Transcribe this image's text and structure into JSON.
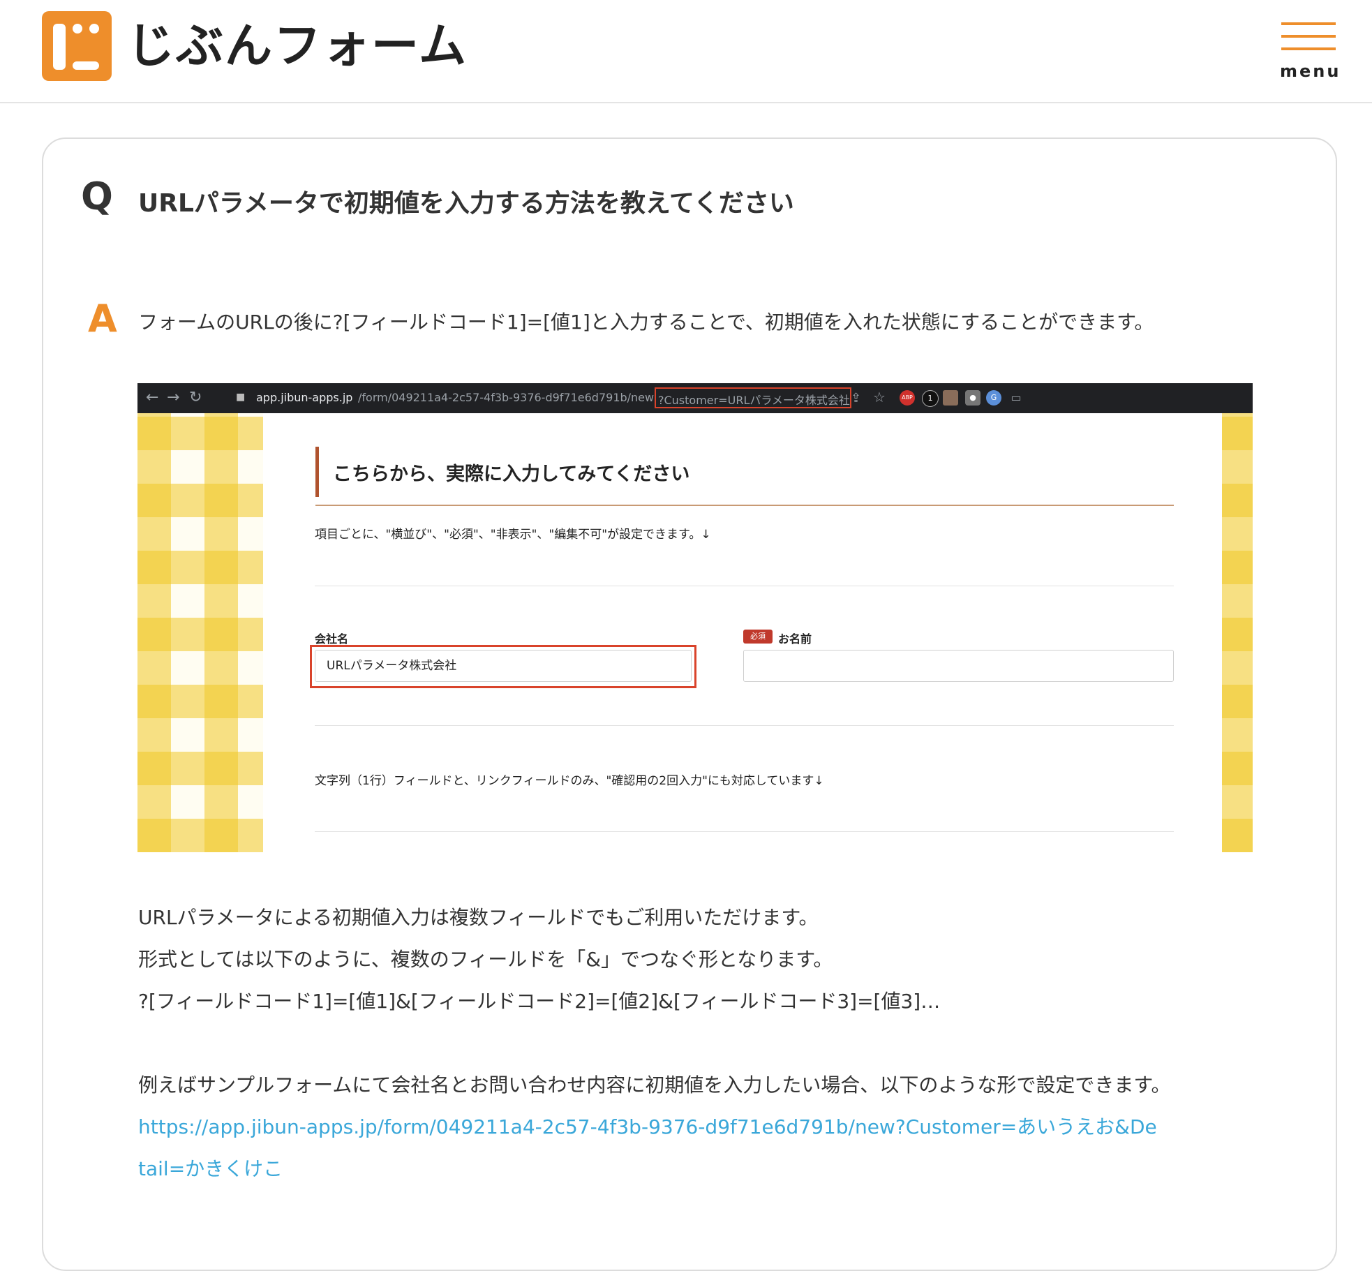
{
  "header": {
    "logo_text": "じぶんフォーム",
    "menu_label": "menu",
    "brand_color": "#ee8e2b"
  },
  "qa": {
    "q_mark": "Q",
    "question": "URLパラメータで初期値を入力する方法を教えてください",
    "a_mark": "A",
    "answer": "フォームのURLの後に?[フィールドコード1]=[値1]と入力することで、初期値を入れた状態にすることができます。"
  },
  "screenshot": {
    "browser": {
      "url_host": "app.jibun-apps.jp",
      "url_path": "/form/049211a4-2c57-4f3b-9376-d9f71e6d791b/new",
      "url_query": "?Customer=URLパラメータ株式会社",
      "extensions": [
        "share-icon",
        "star-icon",
        "adblock-icon",
        "onepassword-icon",
        "extension-icon",
        "camera-icon",
        "profile-icon",
        "cast-icon"
      ]
    },
    "form": {
      "title": "こちらから、実際に入力してみてください",
      "description1": "項目ごとに、\"横並び\"、\"必須\"、\"非表示\"、\"編集不可\"が設定できます。↓",
      "company_label": "会社名",
      "company_value": "URLパラメータ株式会社",
      "required_badge": "必須",
      "name_label": "お名前",
      "name_value": "",
      "description2": "文字列（1行）フィールドと、リンクフィールドのみ、\"確認用の2回入力\"にも対応しています↓"
    }
  },
  "explanation": {
    "line1": "URLパラメータによる初期値入力は複数フィールドでもご利用いただけます。",
    "line2": "形式としては以下のように、複数のフィールドを「&」でつなぐ形となります。",
    "line3": "?[フィールドコード1]=[値1]&[フィールドコード2]=[値2]&[フィールドコード3]=[値3]…",
    "line4": "例えばサンプルフォームにて会社名とお問い合わせ内容に初期値を入力したい場合、以下のような形で設定できます。",
    "link_line1": "https://app.jibun-apps.jp/form/049211a4-2c57-4f3b-9376-d9f71e6d791b/new?Customer=あいうえお&De",
    "link_line2": "tail=かきくけこ"
  }
}
